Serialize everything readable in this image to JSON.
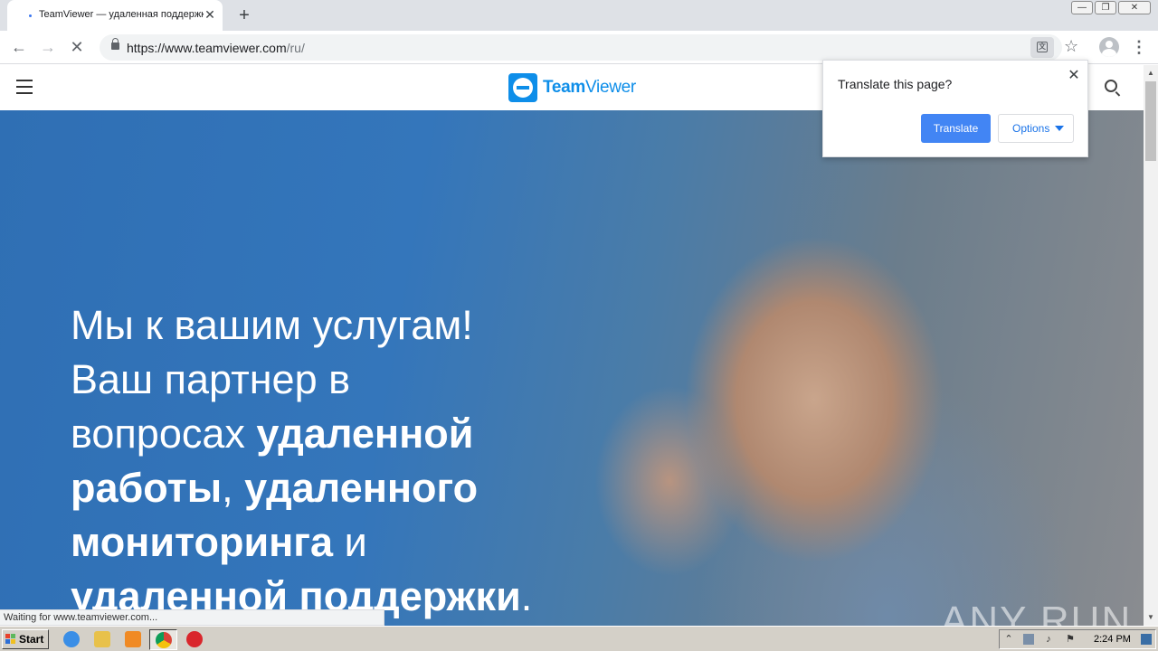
{
  "browser": {
    "tab": {
      "title": "TeamViewer — удаленная поддержка"
    },
    "new_tab_label": "+",
    "window_controls": {
      "minimize": "—",
      "restore": "❐",
      "close": "✕"
    },
    "url": {
      "host": "https://www.teamviewer.com",
      "path": "/ru/"
    },
    "status_text": "Waiting for www.teamviewer.com..."
  },
  "site": {
    "logo": {
      "bold": "Team",
      "regular": "Viewer"
    },
    "hero": {
      "line1": "Мы к вашим услугам!",
      "line2": "Ваш партнер в",
      "line3_regular": "вопросах ",
      "line3_bold": "удаленной",
      "line4_bold_a": "работы",
      "line4_regular": ", ",
      "line4_bold_b": "удаленного",
      "line5_bold": "мониторинга",
      "line5_regular": " и",
      "line6_bold": "удаленной поддержки",
      "line6_regular": "."
    }
  },
  "translate_popup": {
    "title": "Translate this page?",
    "translate_button": "Translate",
    "options_button": "Options"
  },
  "watermark": "ANY RUN",
  "taskbar": {
    "start_label": "Start",
    "clock": "2:24 PM"
  },
  "colors": {
    "accent_blue": "#4285f4",
    "brand_blue": "#0e8ee9",
    "hero_blue": "#2f6fb4"
  }
}
